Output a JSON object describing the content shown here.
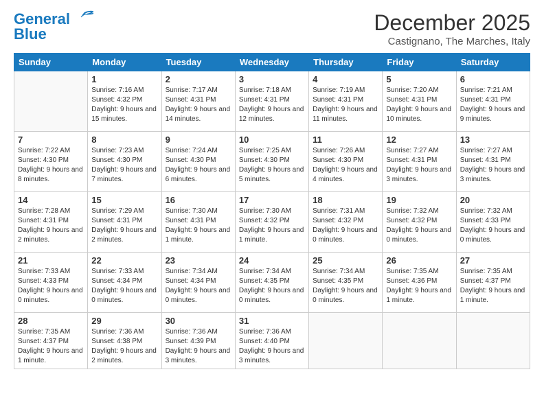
{
  "header": {
    "logo": {
      "line1": "General",
      "line2": "Blue"
    },
    "title": "December 2025",
    "location": "Castignano, The Marches, Italy"
  },
  "weekdays": [
    "Sunday",
    "Monday",
    "Tuesday",
    "Wednesday",
    "Thursday",
    "Friday",
    "Saturday"
  ],
  "weeks": [
    [
      {
        "day": null
      },
      {
        "day": 1,
        "sunrise": "7:16 AM",
        "sunset": "4:32 PM",
        "daylight": "9 hours and 15 minutes."
      },
      {
        "day": 2,
        "sunrise": "7:17 AM",
        "sunset": "4:31 PM",
        "daylight": "9 hours and 14 minutes."
      },
      {
        "day": 3,
        "sunrise": "7:18 AM",
        "sunset": "4:31 PM",
        "daylight": "9 hours and 12 minutes."
      },
      {
        "day": 4,
        "sunrise": "7:19 AM",
        "sunset": "4:31 PM",
        "daylight": "9 hours and 11 minutes."
      },
      {
        "day": 5,
        "sunrise": "7:20 AM",
        "sunset": "4:31 PM",
        "daylight": "9 hours and 10 minutes."
      },
      {
        "day": 6,
        "sunrise": "7:21 AM",
        "sunset": "4:31 PM",
        "daylight": "9 hours and 9 minutes."
      }
    ],
    [
      {
        "day": 7,
        "sunrise": "7:22 AM",
        "sunset": "4:30 PM",
        "daylight": "9 hours and 8 minutes."
      },
      {
        "day": 8,
        "sunrise": "7:23 AM",
        "sunset": "4:30 PM",
        "daylight": "9 hours and 7 minutes."
      },
      {
        "day": 9,
        "sunrise": "7:24 AM",
        "sunset": "4:30 PM",
        "daylight": "9 hours and 6 minutes."
      },
      {
        "day": 10,
        "sunrise": "7:25 AM",
        "sunset": "4:30 PM",
        "daylight": "9 hours and 5 minutes."
      },
      {
        "day": 11,
        "sunrise": "7:26 AM",
        "sunset": "4:30 PM",
        "daylight": "9 hours and 4 minutes."
      },
      {
        "day": 12,
        "sunrise": "7:27 AM",
        "sunset": "4:31 PM",
        "daylight": "9 hours and 3 minutes."
      },
      {
        "day": 13,
        "sunrise": "7:27 AM",
        "sunset": "4:31 PM",
        "daylight": "9 hours and 3 minutes."
      }
    ],
    [
      {
        "day": 14,
        "sunrise": "7:28 AM",
        "sunset": "4:31 PM",
        "daylight": "9 hours and 2 minutes."
      },
      {
        "day": 15,
        "sunrise": "7:29 AM",
        "sunset": "4:31 PM",
        "daylight": "9 hours and 2 minutes."
      },
      {
        "day": 16,
        "sunrise": "7:30 AM",
        "sunset": "4:31 PM",
        "daylight": "9 hours and 1 minute."
      },
      {
        "day": 17,
        "sunrise": "7:30 AM",
        "sunset": "4:32 PM",
        "daylight": "9 hours and 1 minute."
      },
      {
        "day": 18,
        "sunrise": "7:31 AM",
        "sunset": "4:32 PM",
        "daylight": "9 hours and 0 minutes."
      },
      {
        "day": 19,
        "sunrise": "7:32 AM",
        "sunset": "4:32 PM",
        "daylight": "9 hours and 0 minutes."
      },
      {
        "day": 20,
        "sunrise": "7:32 AM",
        "sunset": "4:33 PM",
        "daylight": "9 hours and 0 minutes."
      }
    ],
    [
      {
        "day": 21,
        "sunrise": "7:33 AM",
        "sunset": "4:33 PM",
        "daylight": "9 hours and 0 minutes."
      },
      {
        "day": 22,
        "sunrise": "7:33 AM",
        "sunset": "4:34 PM",
        "daylight": "9 hours and 0 minutes."
      },
      {
        "day": 23,
        "sunrise": "7:34 AM",
        "sunset": "4:34 PM",
        "daylight": "9 hours and 0 minutes."
      },
      {
        "day": 24,
        "sunrise": "7:34 AM",
        "sunset": "4:35 PM",
        "daylight": "9 hours and 0 minutes."
      },
      {
        "day": 25,
        "sunrise": "7:34 AM",
        "sunset": "4:35 PM",
        "daylight": "9 hours and 0 minutes."
      },
      {
        "day": 26,
        "sunrise": "7:35 AM",
        "sunset": "4:36 PM",
        "daylight": "9 hours and 1 minute."
      },
      {
        "day": 27,
        "sunrise": "7:35 AM",
        "sunset": "4:37 PM",
        "daylight": "9 hours and 1 minute."
      }
    ],
    [
      {
        "day": 28,
        "sunrise": "7:35 AM",
        "sunset": "4:37 PM",
        "daylight": "9 hours and 1 minute."
      },
      {
        "day": 29,
        "sunrise": "7:36 AM",
        "sunset": "4:38 PM",
        "daylight": "9 hours and 2 minutes."
      },
      {
        "day": 30,
        "sunrise": "7:36 AM",
        "sunset": "4:39 PM",
        "daylight": "9 hours and 3 minutes."
      },
      {
        "day": 31,
        "sunrise": "7:36 AM",
        "sunset": "4:40 PM",
        "daylight": "9 hours and 3 minutes."
      },
      {
        "day": null
      },
      {
        "day": null
      },
      {
        "day": null
      }
    ]
  ]
}
